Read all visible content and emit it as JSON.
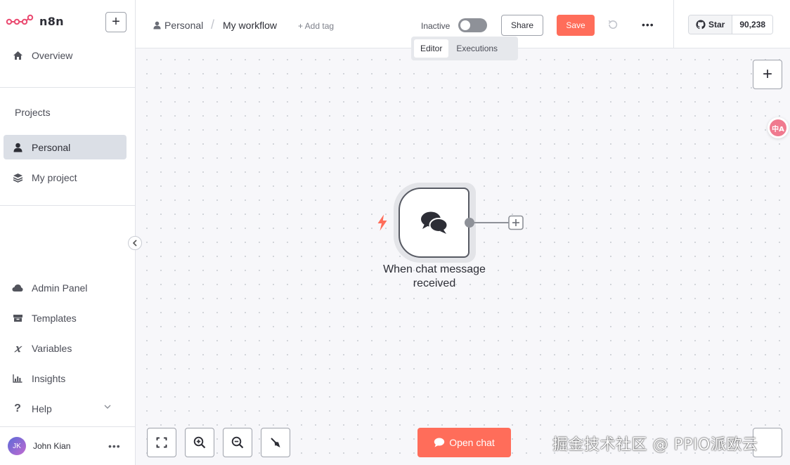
{
  "app": {
    "logo_text": "n8n"
  },
  "sidebar": {
    "overview": "Overview",
    "projects_title": "Projects",
    "personal": "Personal",
    "my_project": "My project",
    "admin_panel": "Admin Panel",
    "templates": "Templates",
    "variables": "Variables",
    "insights": "Insights",
    "help": "Help",
    "user": {
      "initials": "JK",
      "name": "John Kian"
    }
  },
  "header": {
    "breadcrumb_project": "Personal",
    "workflow_name": "My workflow",
    "add_tag": "+ Add tag",
    "status_label": "Inactive",
    "active": false,
    "share": "Share",
    "save": "Save",
    "github": {
      "star": "Star",
      "count": "90,238"
    }
  },
  "tabs": [
    {
      "label": "Editor",
      "active": true
    },
    {
      "label": "Executions",
      "active": false
    }
  ],
  "canvas": {
    "node": {
      "label": "When chat message received",
      "icon": "chat-bubbles-icon",
      "trigger_icon": "lightning-icon"
    },
    "open_chat": "Open chat",
    "translate_badge": "中A"
  },
  "overlay": {
    "watermark": "掘金技术社区 @ PPIO派欧云"
  },
  "colors": {
    "accent": "#ff6d5a",
    "active_nav": "#dbdfe6",
    "trigger": "#ff6d5a"
  }
}
